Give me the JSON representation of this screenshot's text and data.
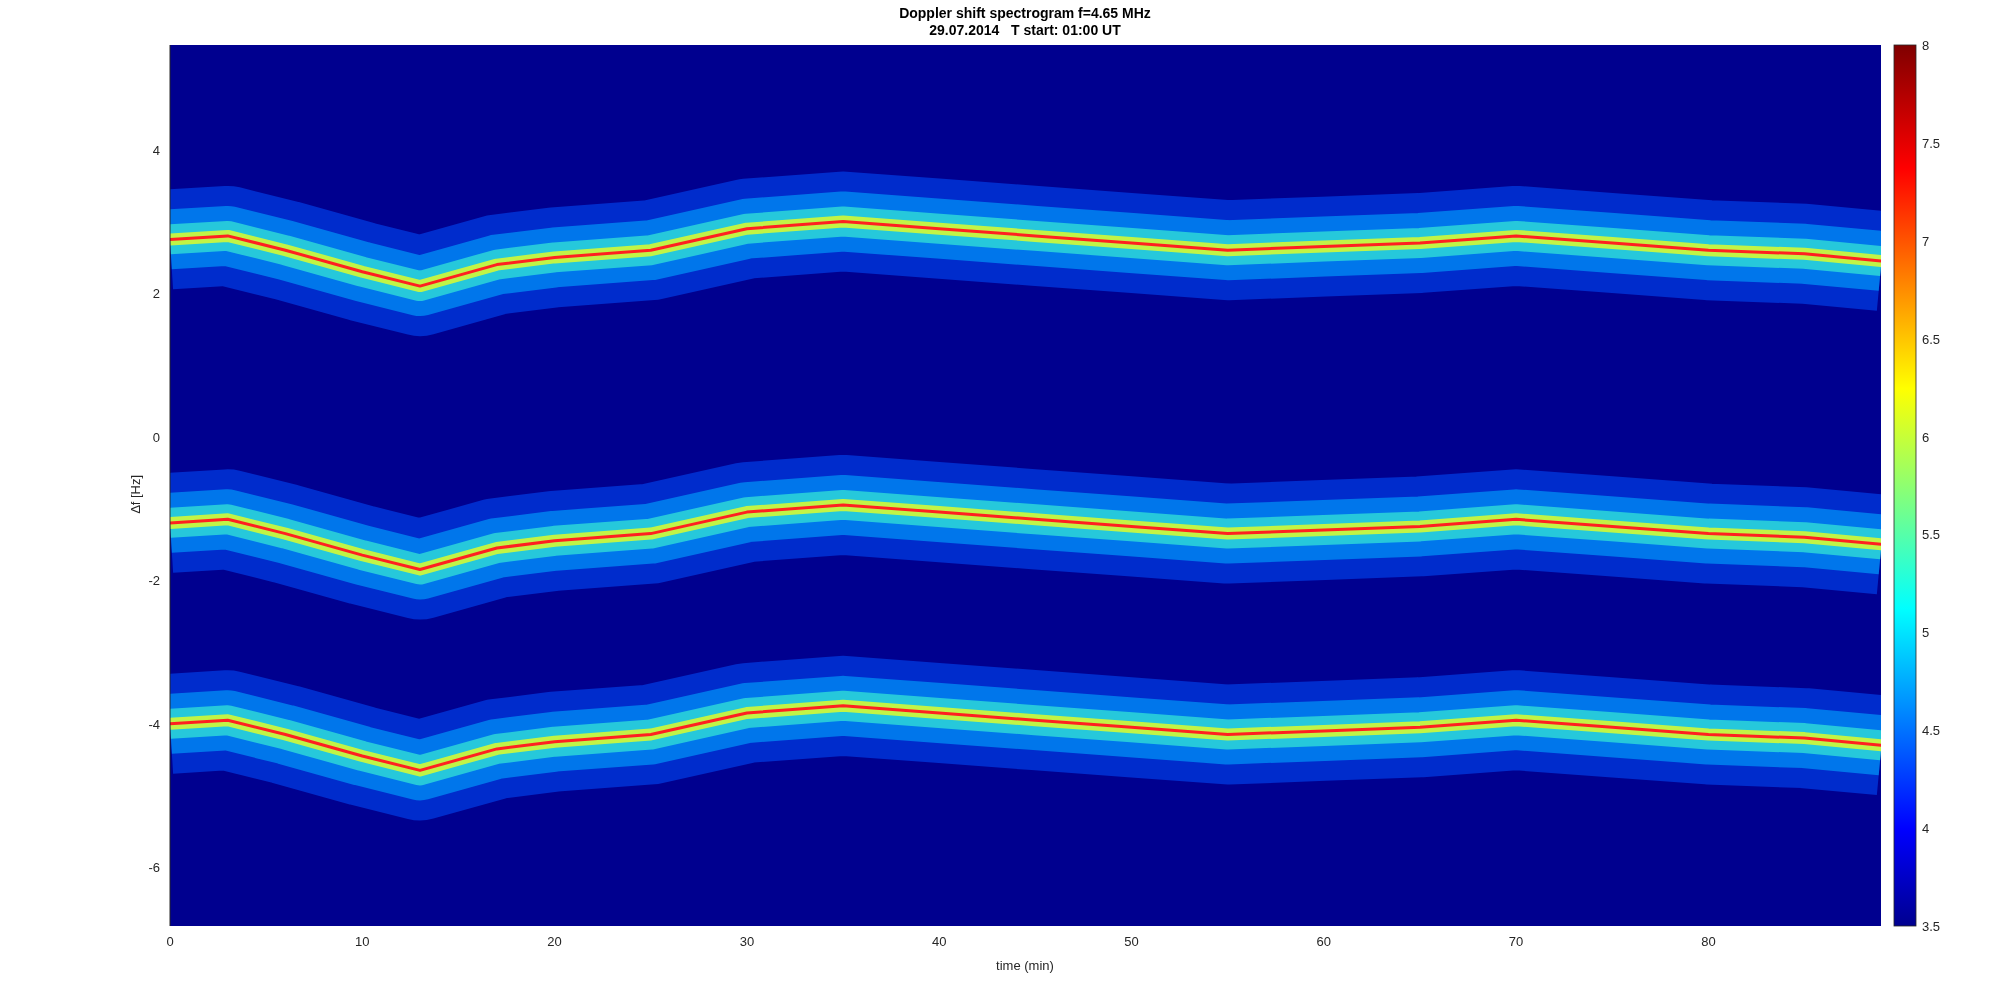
{
  "title": [
    "Doppler shift spectrogram f=4.65 MHz",
    "29.07.2014   T start: 01:00 UT"
  ],
  "xlabel": "time (min)",
  "ylabel": "∆f [Hz]",
  "xticks": [
    "0",
    "10",
    "20",
    "30",
    "40",
    "50",
    "60",
    "70",
    "80"
  ],
  "yticks": [
    "4",
    "2",
    "0",
    "-2",
    "-4",
    "-6"
  ],
  "colorbar_ticks": [
    "8",
    "7.5",
    "7",
    "6.5",
    "6",
    "5.5",
    "5",
    "4.5",
    "4",
    "3.5"
  ]
}
